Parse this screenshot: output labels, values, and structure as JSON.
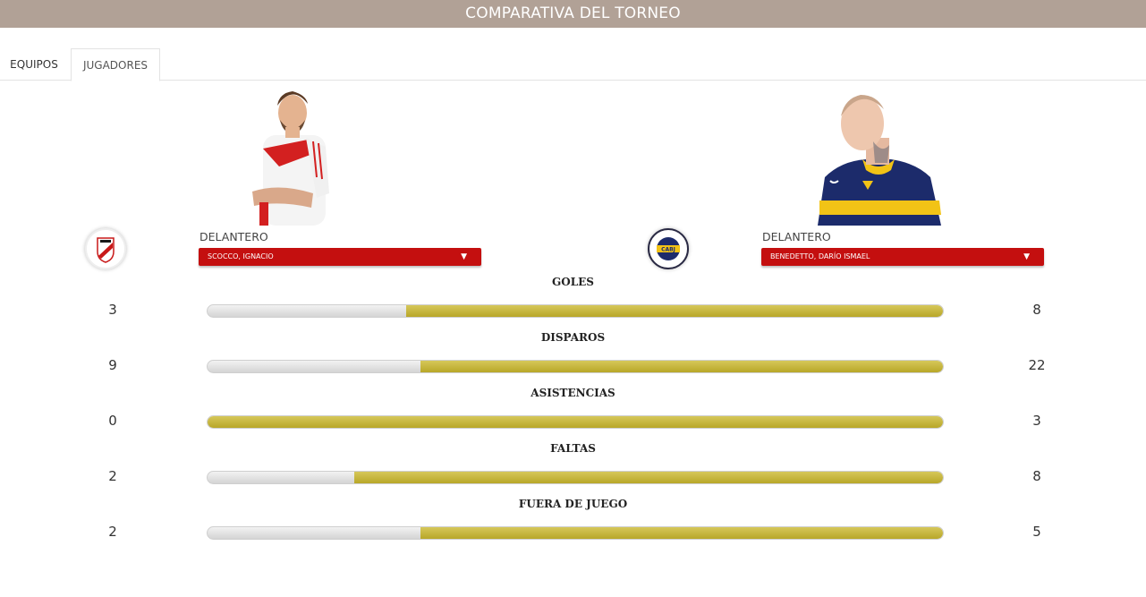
{
  "header": {
    "title": "COMPARATIVA DEL TORNEO"
  },
  "tabs": [
    {
      "label": "EQUIPOS"
    },
    {
      "label": "JUGADORES"
    }
  ],
  "left_player": {
    "position": "DELANTERO",
    "name": "SCOCCO, IGNACIO",
    "shirt_color": "#d32020"
  },
  "right_player": {
    "position": "DELANTERO",
    "name": "BENEDETTO, DARÍO ISMAEL",
    "shirt_color": "#1c2b6b"
  },
  "colors": {
    "header_bg": "#b1a196",
    "select_bg": "#c40f0f",
    "bar_fill": "#c9b83a",
    "bar_track": "#dedede"
  },
  "stats": [
    {
      "label": "GOLES",
      "left": "3",
      "right": "8",
      "left_share": 0.27
    },
    {
      "label": "DISPAROS",
      "left": "9",
      "right": "22",
      "left_share": 0.29
    },
    {
      "label": "ASISTENCIAS",
      "left": "0",
      "right": "3",
      "left_share": 0.0
    },
    {
      "label": "FALTAS",
      "left": "2",
      "right": "8",
      "left_share": 0.2
    },
    {
      "label": "FUERA DE JUEGO",
      "left": "2",
      "right": "5",
      "left_share": 0.29
    }
  ]
}
